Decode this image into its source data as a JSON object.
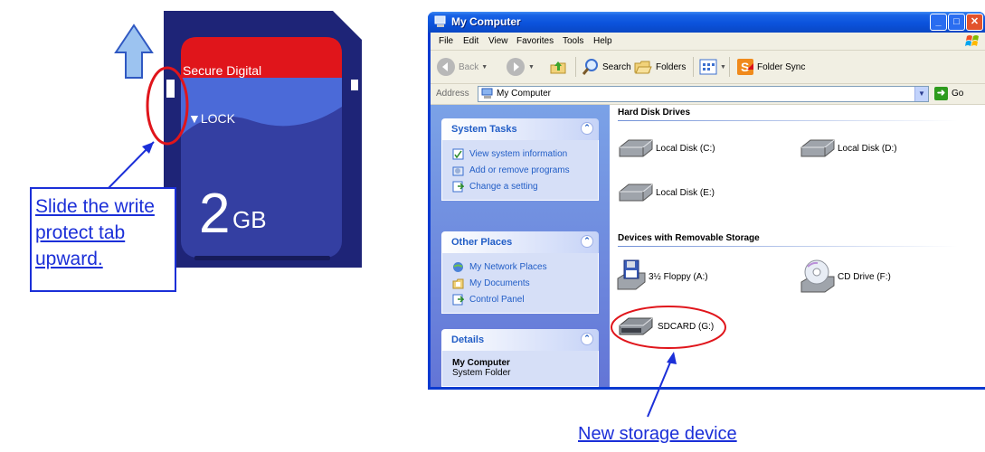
{
  "sd_card": {
    "brand": "Secure Digital",
    "lock": "▼LOCK",
    "capacity_number": "2",
    "capacity_unit": "GB"
  },
  "instruction": {
    "line1": "Slide the write",
    "line2": "protect tab",
    "line3": "upward."
  },
  "caption": "New storage device",
  "window": {
    "title": "My Computer",
    "menu": [
      "File",
      "Edit",
      "View",
      "Favorites",
      "Tools",
      "Help"
    ],
    "toolbar": {
      "back": "Back",
      "search": "Search",
      "folders": "Folders",
      "folder_sync": "Folder Sync"
    },
    "address": {
      "label": "Address",
      "value": "My Computer",
      "go": "Go"
    }
  },
  "tasks": {
    "system": {
      "title": "System Tasks",
      "items": [
        "View system information",
        "Add or remove programs",
        "Change a setting"
      ]
    },
    "other": {
      "title": "Other Places",
      "items": [
        "My Network Places",
        "My Documents",
        "Control Panel"
      ]
    },
    "details": {
      "title": "Details",
      "name": "My Computer",
      "type": "System Folder"
    }
  },
  "content": {
    "hard_disks_title": "Hard Disk Drives",
    "hard_disks": [
      "Local Disk (C:)",
      "Local Disk (D:)",
      "Local Disk (E:)"
    ],
    "removable_title": "Devices with Removable Storage",
    "removable": [
      "3½ Floppy (A:)",
      "CD Drive (F:)",
      "SDCARD (G:)"
    ]
  },
  "colors": {
    "annotation_blue": "#1b2fd8",
    "highlight_red": "#e0151b",
    "card_navy": "#232b7e",
    "card_red": "#e0151b",
    "xp_blue": "#0a3ad0"
  }
}
